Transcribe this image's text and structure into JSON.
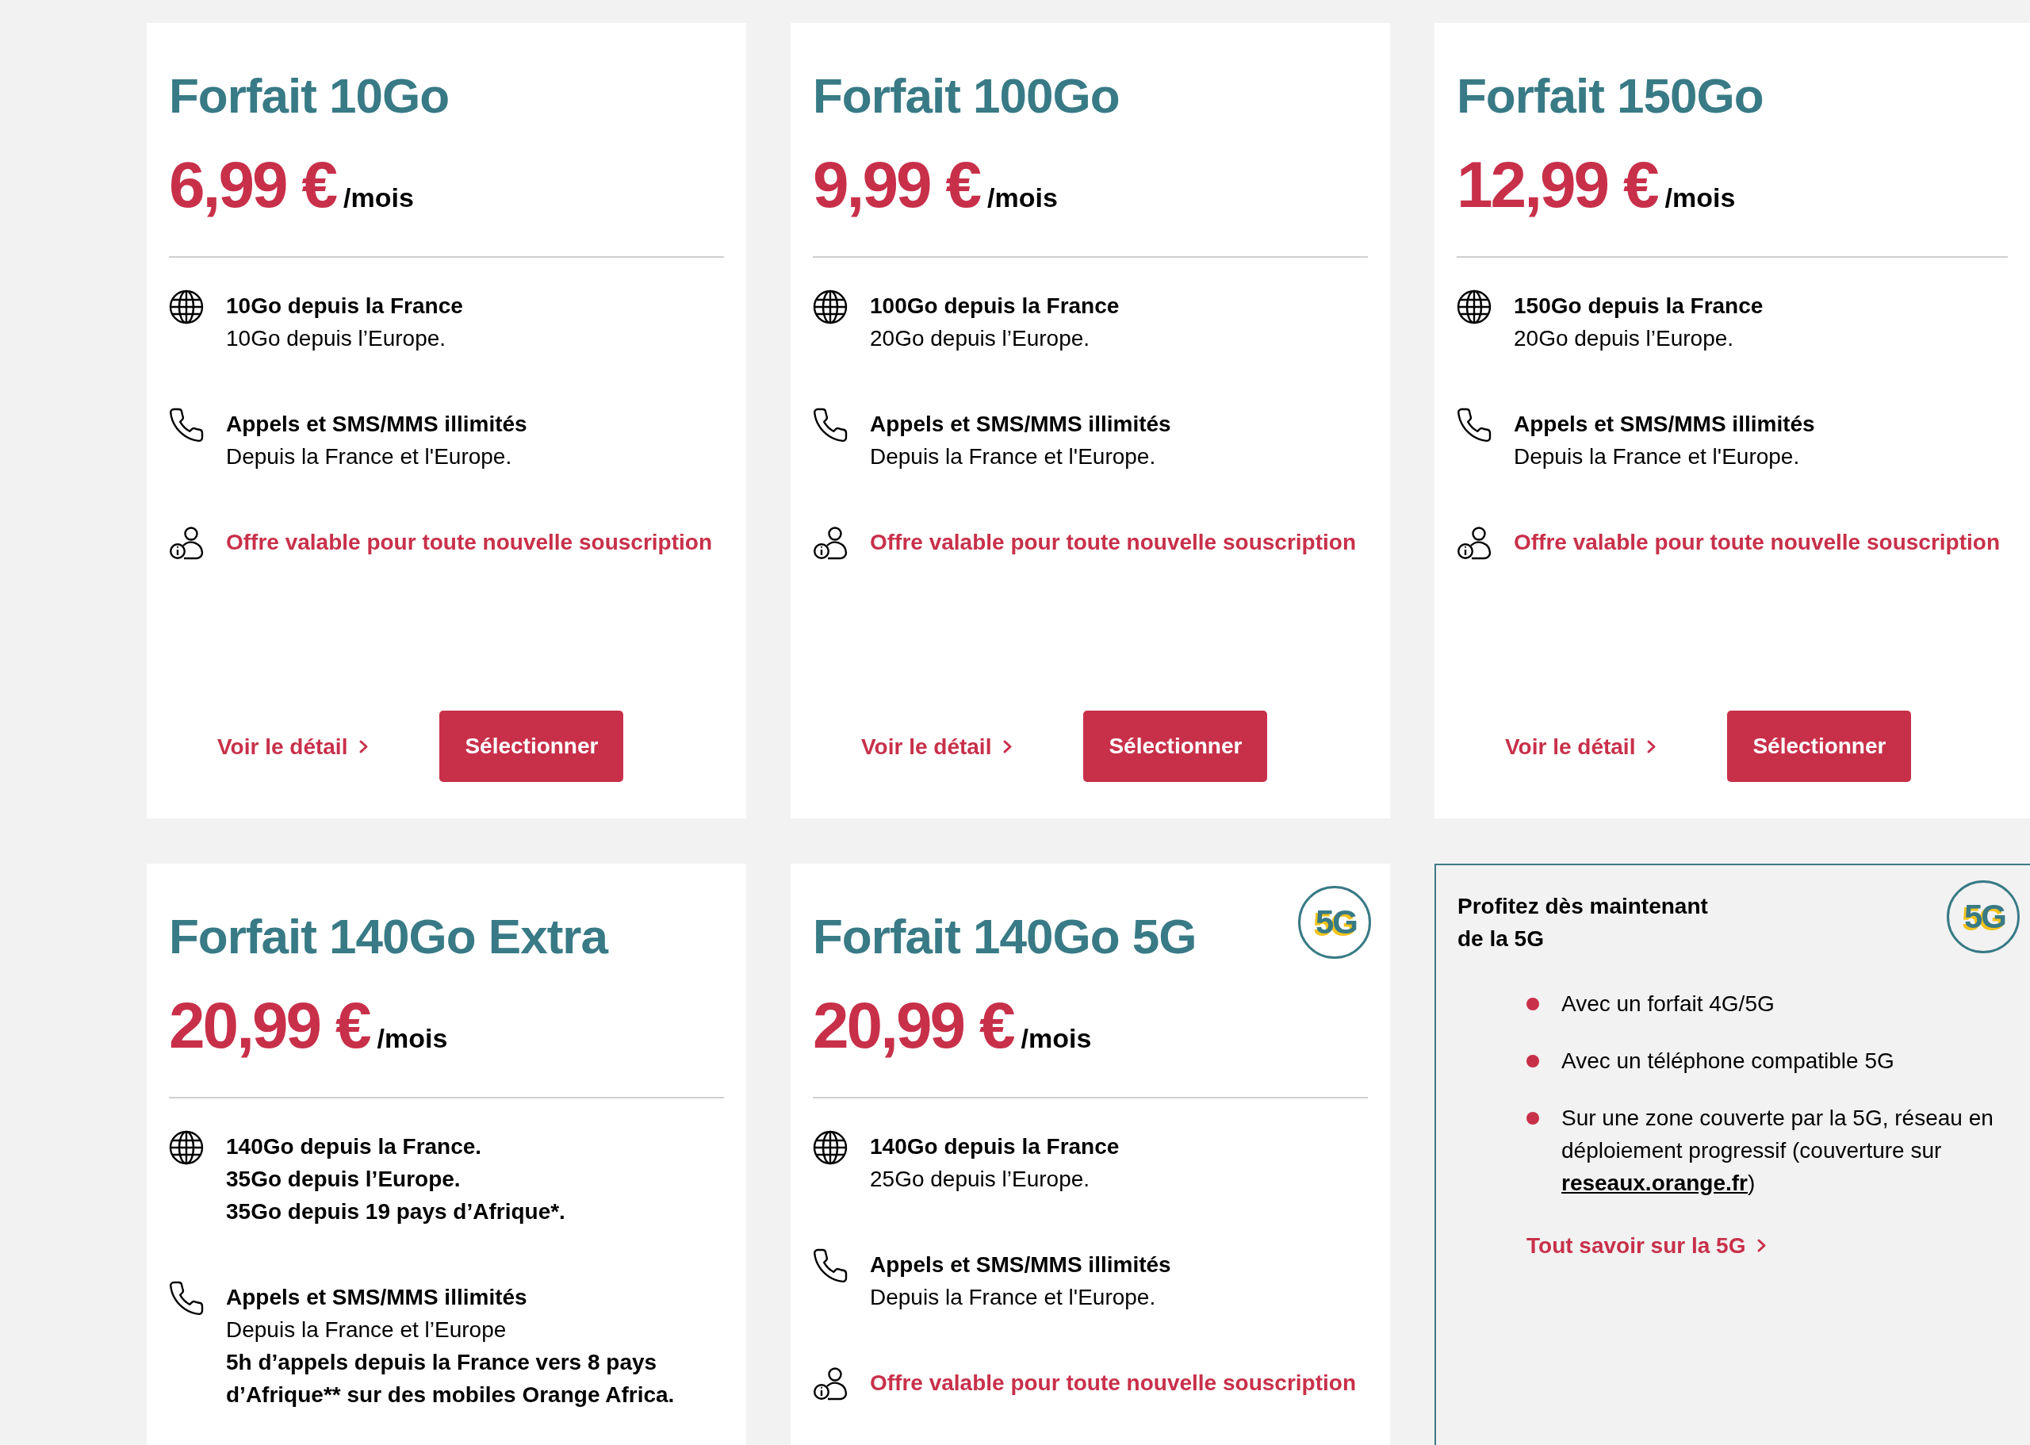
{
  "cards": [
    {
      "kind": "plan",
      "title": "Forfait 10Go",
      "price": "6,99 €",
      "period": "/mois",
      "features": [
        {
          "kind": "data",
          "lines": [
            {
              "text": "10Go depuis la France",
              "bold": true
            },
            {
              "text": "10Go depuis l’Europe.",
              "bold": false
            }
          ]
        },
        {
          "kind": "calls",
          "lines": [
            {
              "text": "Appels et SMS/MMS illimités",
              "bold": true
            },
            {
              "text": "Depuis la France et l'Europe.",
              "bold": false
            }
          ]
        },
        {
          "kind": "offer",
          "lines": [
            {
              "text": "Offre valable pour toute nouvelle souscription",
              "bold": true
            }
          ]
        }
      ],
      "detail_link": "Voir le détail",
      "select_button": "Sélectionner"
    },
    {
      "kind": "plan",
      "title": "Forfait 100Go",
      "price": "9,99 €",
      "period": "/mois",
      "features": [
        {
          "kind": "data",
          "lines": [
            {
              "text": "100Go depuis la France",
              "bold": true
            },
            {
              "text": "20Go depuis l’Europe.",
              "bold": false
            }
          ]
        },
        {
          "kind": "calls",
          "lines": [
            {
              "text": "Appels et SMS/MMS illimités",
              "bold": true
            },
            {
              "text": "Depuis la France et l'Europe.",
              "bold": false
            }
          ]
        },
        {
          "kind": "offer",
          "lines": [
            {
              "text": "Offre valable pour toute nouvelle souscription",
              "bold": true
            }
          ]
        }
      ],
      "detail_link": "Voir le détail",
      "select_button": "Sélectionner"
    },
    {
      "kind": "plan",
      "title": "Forfait 150Go",
      "price": "12,99 €",
      "period": "/mois",
      "features": [
        {
          "kind": "data",
          "lines": [
            {
              "text": "150Go depuis la France",
              "bold": true
            },
            {
              "text": "20Go depuis l’Europe.",
              "bold": false
            }
          ]
        },
        {
          "kind": "calls",
          "lines": [
            {
              "text": "Appels et SMS/MMS illimités",
              "bold": true
            },
            {
              "text": "Depuis la France et l'Europe.",
              "bold": false
            }
          ]
        },
        {
          "kind": "offer",
          "lines": [
            {
              "text": "Offre valable pour toute nouvelle souscription",
              "bold": true
            }
          ]
        }
      ],
      "detail_link": "Voir le détail",
      "select_button": "Sélectionner"
    },
    {
      "kind": "plan",
      "title": "Forfait 140Go Extra",
      "price": "20,99 €",
      "period": "/mois",
      "features": [
        {
          "kind": "data",
          "lines": [
            {
              "text": "140Go depuis la France.",
              "bold": true
            },
            {
              "text": "35Go depuis l’Europe.",
              "bold": true
            },
            {
              "text": "35Go depuis 19 pays d’Afrique*.",
              "bold": true
            }
          ]
        },
        {
          "kind": "calls",
          "lines": [
            {
              "text": "Appels et SMS/MMS illimités",
              "bold": true
            },
            {
              "text": "Depuis la France et l’Europe",
              "bold": false
            },
            {
              "text": "5h d’appels depuis la France vers 8 pays d’Afrique** sur des mobiles Orange Africa.",
              "bold": true
            }
          ]
        }
      ]
    },
    {
      "kind": "plan",
      "title": "Forfait 140Go 5G",
      "badge": "5G",
      "price": "20,99 €",
      "period": "/mois",
      "features": [
        {
          "kind": "data",
          "lines": [
            {
              "text": "140Go depuis la France",
              "bold": true
            },
            {
              "text": "25Go depuis l’Europe.",
              "bold": false
            }
          ]
        },
        {
          "kind": "calls",
          "lines": [
            {
              "text": "Appels et SMS/MMS illimités",
              "bold": true
            },
            {
              "text": "Depuis la France et l'Europe.",
              "bold": false
            }
          ]
        },
        {
          "kind": "offer",
          "lines": [
            {
              "text": "Offre valable pour toute nouvelle souscription",
              "bold": true
            }
          ]
        }
      ]
    },
    {
      "kind": "info",
      "title": "Profitez dès maintenant de la 5G",
      "badge": "5G",
      "bullets": [
        {
          "text": "Avec un forfait 4G/5G"
        },
        {
          "text": "Avec un téléphone compatible 5G"
        },
        {
          "text": "Sur une zone couverte par la 5G, réseau en déploiement progressif (couverture sur ",
          "link": "reseaux.orange.fr",
          "after": ")"
        }
      ],
      "link": "Tout savoir sur la 5G"
    }
  ]
}
